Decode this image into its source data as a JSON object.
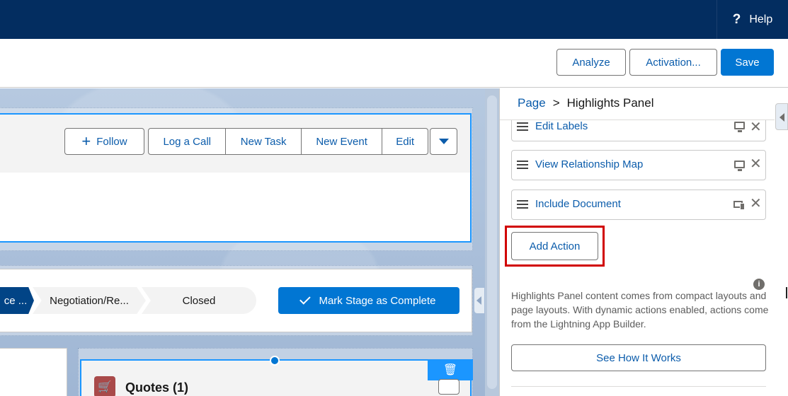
{
  "header": {
    "help_label": "Help"
  },
  "toolbar": {
    "analyze_label": "Analyze",
    "activation_label": "Activation...",
    "save_label": "Save"
  },
  "canvas": {
    "highlights_actions": {
      "follow_label": "Follow",
      "group": [
        "Log a Call",
        "New Task",
        "New Event",
        "Edit"
      ]
    },
    "path": {
      "active_stage": "ce ...",
      "stages": [
        "Negotiation/Re...",
        "Closed"
      ],
      "mark_complete_label": "Mark Stage as Complete"
    },
    "quotes_card": {
      "title": "Quotes (1)"
    }
  },
  "panel": {
    "breadcrumb": {
      "root": "Page",
      "separator": ">",
      "current": "Highlights Panel"
    },
    "actions": [
      {
        "label": "Edit Labels",
        "icon": "desktop-icon"
      },
      {
        "label": "View Relationship Map",
        "icon": "desktop-icon"
      },
      {
        "label": "Include Document",
        "icon": "desktop-phone-icon"
      }
    ],
    "add_action_label": "Add Action",
    "description": "Highlights Panel content comes from compact layouts and page layouts. With dynamic actions enabled, actions come from the Lightning App Builder.",
    "see_how_label": "See How It Works"
  },
  "colors": {
    "nav": "#032d60",
    "brand": "#0176d3",
    "link": "#0b5cab",
    "highlight": "#d10000"
  }
}
